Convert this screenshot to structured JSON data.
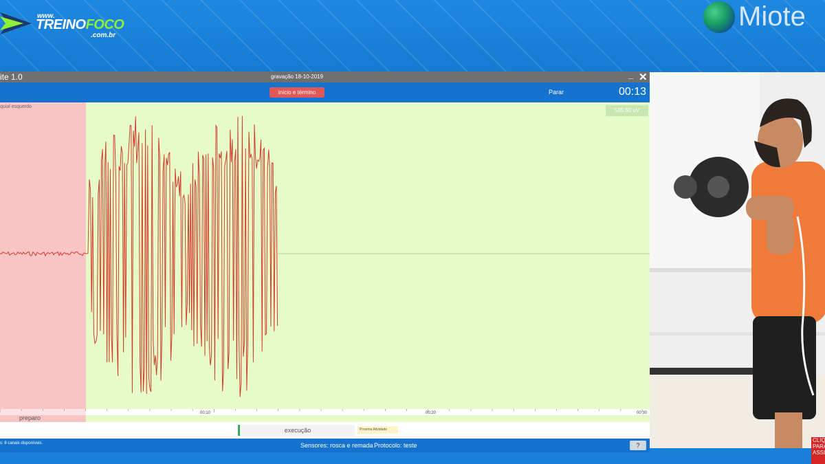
{
  "banner": {
    "left_logo": {
      "www": "www.",
      "brand_a": "TREINO",
      "brand_b": "FOCO",
      "domain": ".com.br"
    },
    "right_logo": {
      "name": "Miote"
    }
  },
  "window": {
    "app_title": "ite 1.0",
    "recording": "gravação 18-10-2019",
    "minimize_icon": "_",
    "close_icon": "✕"
  },
  "toolbar": {
    "start_end_label": "início e término",
    "stop_label": "Parar",
    "timer": "00:13"
  },
  "plot": {
    "muscle_label": "quial esquerdo",
    "scale_label": "535.50 uV",
    "colors": {
      "prep_zone": "#f9c4c4",
      "exec_zone": "#e6fbc8",
      "signal": "#d13c2c"
    }
  },
  "timeline": {
    "ticks": [
      "00:10",
      "00:20",
      "00:30"
    ],
    "prep_label": "preparo",
    "exec_label": "execução",
    "next_activity": "Proxima Atividade"
  },
  "bottombar": {
    "channels": "s: 8 canais disponíveis.",
    "sensores": "Sensores: rosca e remada",
    "protocolo": "Protocolo: teste",
    "help": "?"
  },
  "cta": {
    "text": "CLIQ PARA ASSI"
  }
}
